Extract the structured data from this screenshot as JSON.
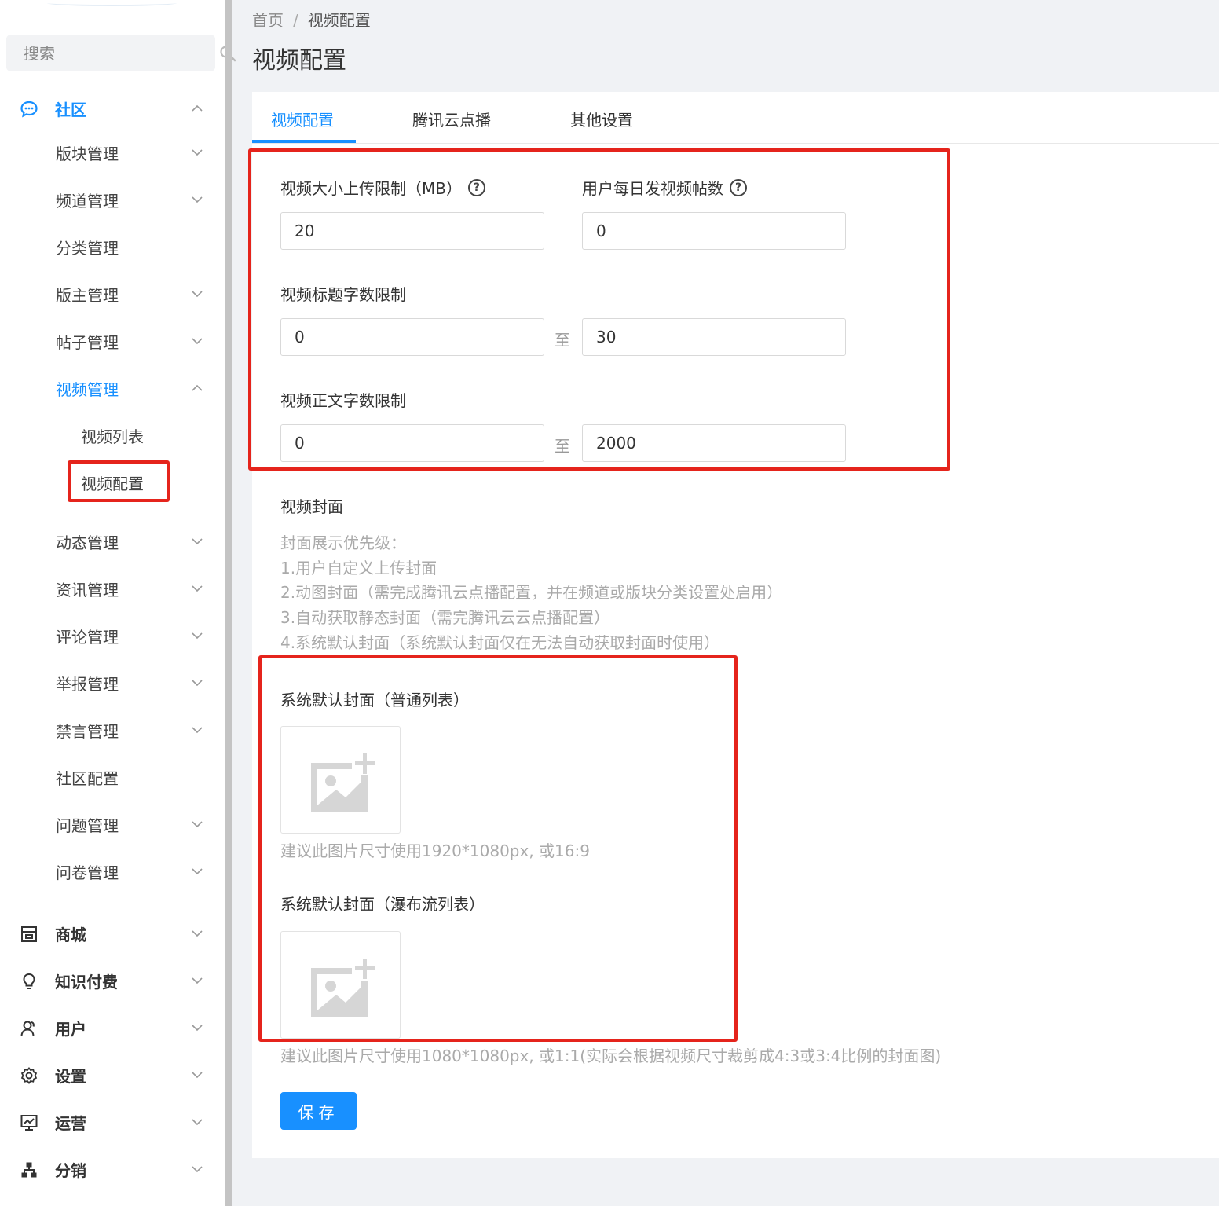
{
  "search": {
    "placeholder": "搜索"
  },
  "sidebar": {
    "community": "社区",
    "items": [
      {
        "label": "版块管理"
      },
      {
        "label": "频道管理"
      },
      {
        "label": "分类管理"
      },
      {
        "label": "版主管理"
      },
      {
        "label": "帖子管理"
      },
      {
        "label": "视频管理"
      },
      {
        "label": "视频列表"
      },
      {
        "label": "视频配置"
      },
      {
        "label": "动态管理"
      },
      {
        "label": "资讯管理"
      },
      {
        "label": "评论管理"
      },
      {
        "label": "举报管理"
      },
      {
        "label": "禁言管理"
      },
      {
        "label": "社区配置"
      },
      {
        "label": "问题管理"
      },
      {
        "label": "问卷管理"
      }
    ],
    "groups": [
      {
        "label": "商城"
      },
      {
        "label": "知识付费"
      },
      {
        "label": "用户"
      },
      {
        "label": "设置"
      },
      {
        "label": "运营"
      },
      {
        "label": "分销"
      }
    ]
  },
  "breadcrumb": {
    "home": "首页",
    "separator": "/",
    "current": "视频配置"
  },
  "page_title": "视频配置",
  "tabs": [
    {
      "label": "视频配置"
    },
    {
      "label": "腾讯云点播"
    },
    {
      "label": "其他设置"
    }
  ],
  "form": {
    "size_limit_label": "视频大小上传限制（MB）",
    "size_limit_value": "20",
    "daily_posts_label": "用户每日发视频帖数",
    "daily_posts_value": "0",
    "title_limit_label": "视频标题字数限制",
    "title_min": "0",
    "title_max": "30",
    "body_limit_label": "视频正文字数限制",
    "body_min": "0",
    "body_max": "2000",
    "to": "至",
    "cover_label": "视频封面",
    "cover_hints": [
      "封面展示优先级：",
      "1.用户自定义上传封面",
      "2.动图封面（需完成腾讯云点播配置，并在频道或版块分类设置处启用）",
      "3.自动获取静态封面（需完腾讯云云点播配置）",
      "4.系统默认封面（系统默认封面仅在无法自动获取封面时使用）"
    ],
    "default_cover_list_label": "系统默认封面（普通列表）",
    "default_cover_list_hint": "建议此图片尺寸使用1920*1080px, 或16:9",
    "default_cover_waterfall_label": "系统默认封面（瀑布流列表）",
    "default_cover_waterfall_hint": "建议此图片尺寸使用1080*1080px, 或1:1(实际会根据视频尺寸裁剪成4:3或3:4比例的封面图)",
    "save": "保存"
  },
  "colors": {
    "accent": "#1890ff",
    "highlight": "#e5241c"
  }
}
